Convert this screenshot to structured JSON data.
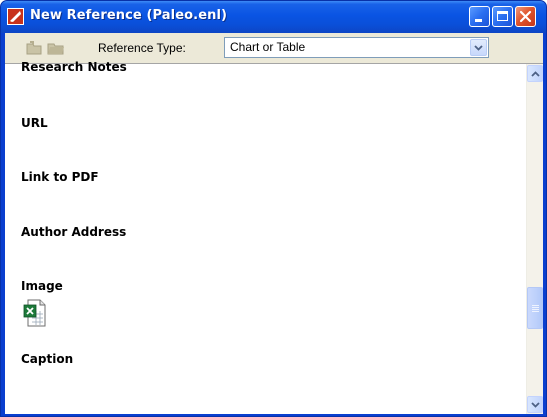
{
  "window": {
    "title": "New Reference (Paleo.enl)"
  },
  "toolbar": {
    "reference_type_label": "Reference Type:",
    "reference_type_value": "Chart or Table"
  },
  "fields": {
    "research_notes": "Research Notes",
    "url": "URL",
    "link_to_pdf": "Link to PDF",
    "author_address": "Author Address",
    "image": "Image",
    "caption": "Caption"
  },
  "icons": {
    "app": "endnote-app-icon",
    "tool_one": "insert-icon",
    "tool_two": "folder-icon",
    "image_attachment": "excel-file-icon"
  },
  "colors": {
    "titlebar": "#0a54e3",
    "close_button": "#e0552d",
    "client_bg": "#ece9d8"
  }
}
